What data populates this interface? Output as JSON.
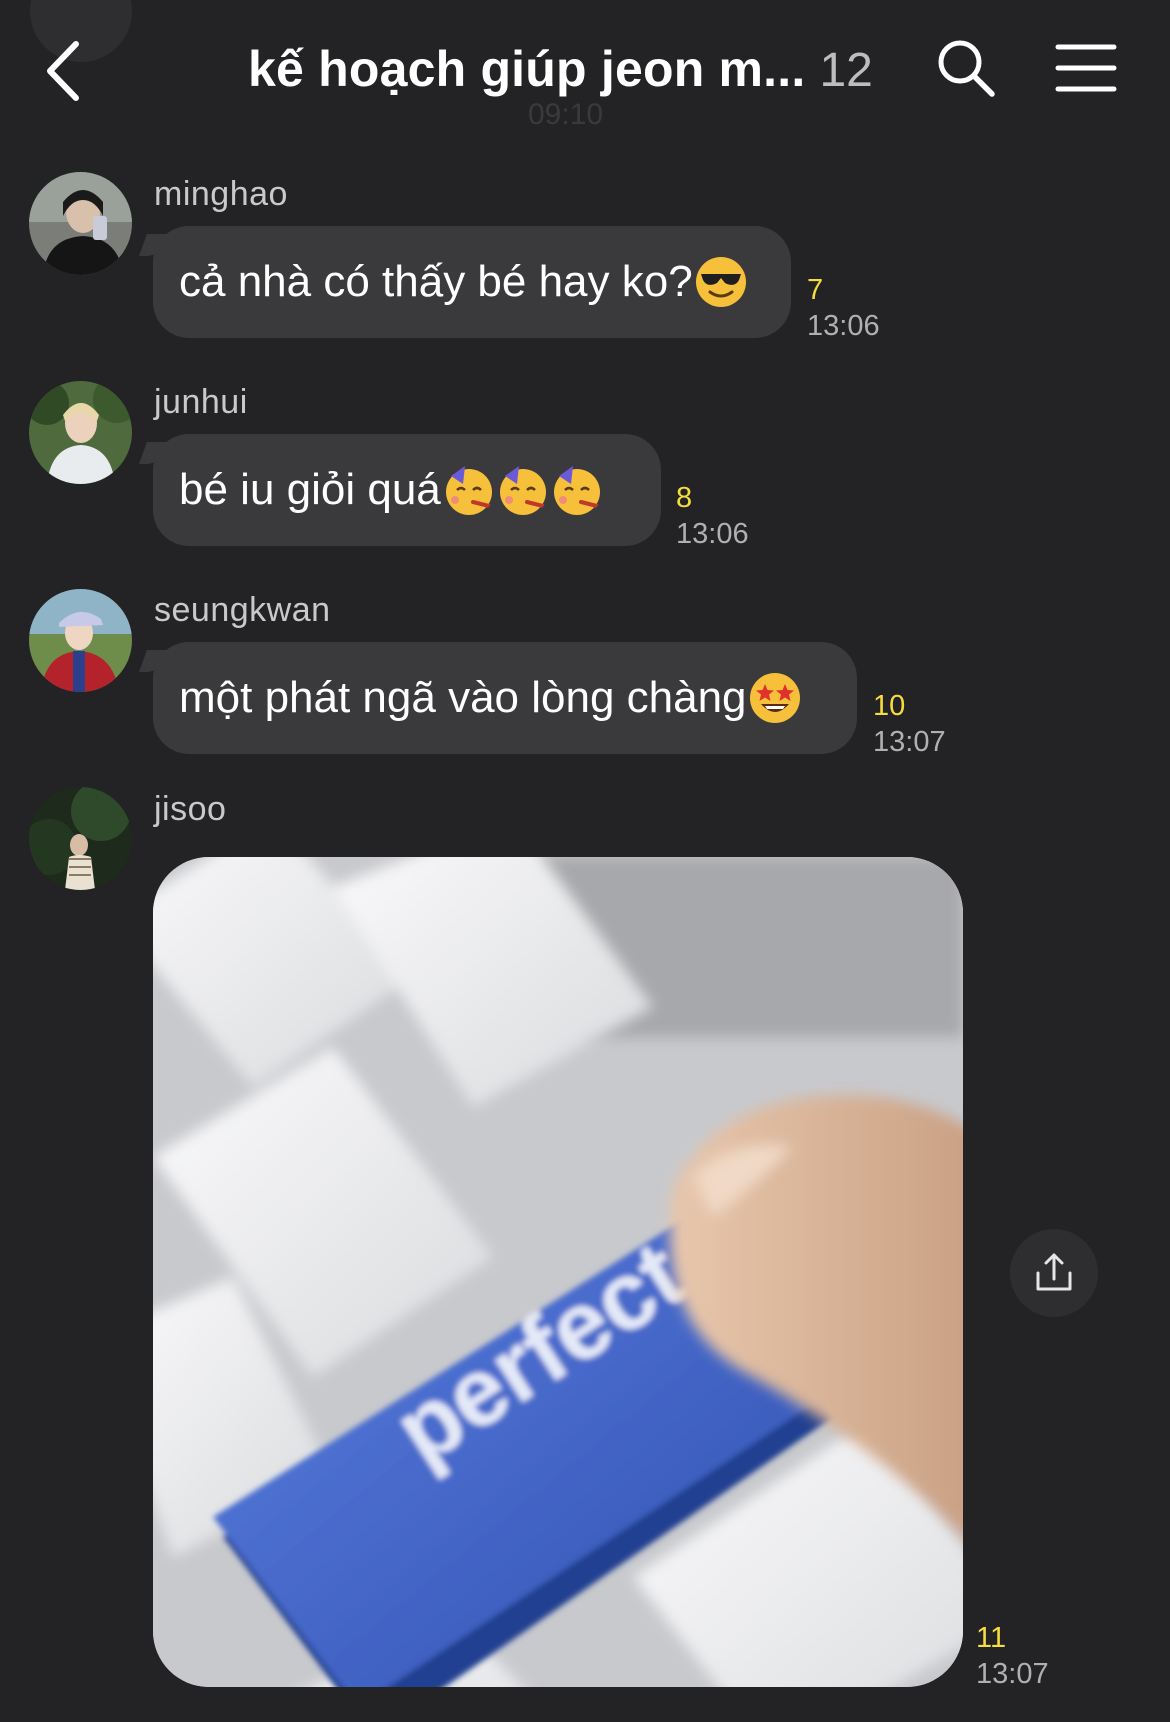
{
  "header": {
    "title": "kế hoạch giúp jeon m...",
    "member_count": "12",
    "ghost_time": "09:10",
    "icons": [
      "chevron-left-icon",
      "search-icon",
      "hamburger-menu-icon"
    ]
  },
  "messages": [
    {
      "sender": "minghao",
      "text": "cả nhà có thấy bé hay ko?",
      "emoji": [
        "smiling-face-with-sunglasses"
      ],
      "unread": "7",
      "time": "13:06"
    },
    {
      "sender": "junhui",
      "text": "bé iu giỏi quá",
      "emoji": [
        "partying-face",
        "partying-face",
        "partying-face"
      ],
      "unread": "8",
      "time": "13:06"
    },
    {
      "sender": "seungkwan",
      "text": "một phát ngã vào lòng chàng",
      "emoji": [
        "star-struck"
      ],
      "unread": "10",
      "time": "13:07"
    },
    {
      "sender": "jisoo",
      "image_text": "perfect",
      "unread": "11",
      "time": "13:07"
    }
  ],
  "colors": {
    "background": "#232325",
    "bubble": "#3a3a3c",
    "unread": "#f7dd3b",
    "key_blue": "#3f63c8"
  }
}
